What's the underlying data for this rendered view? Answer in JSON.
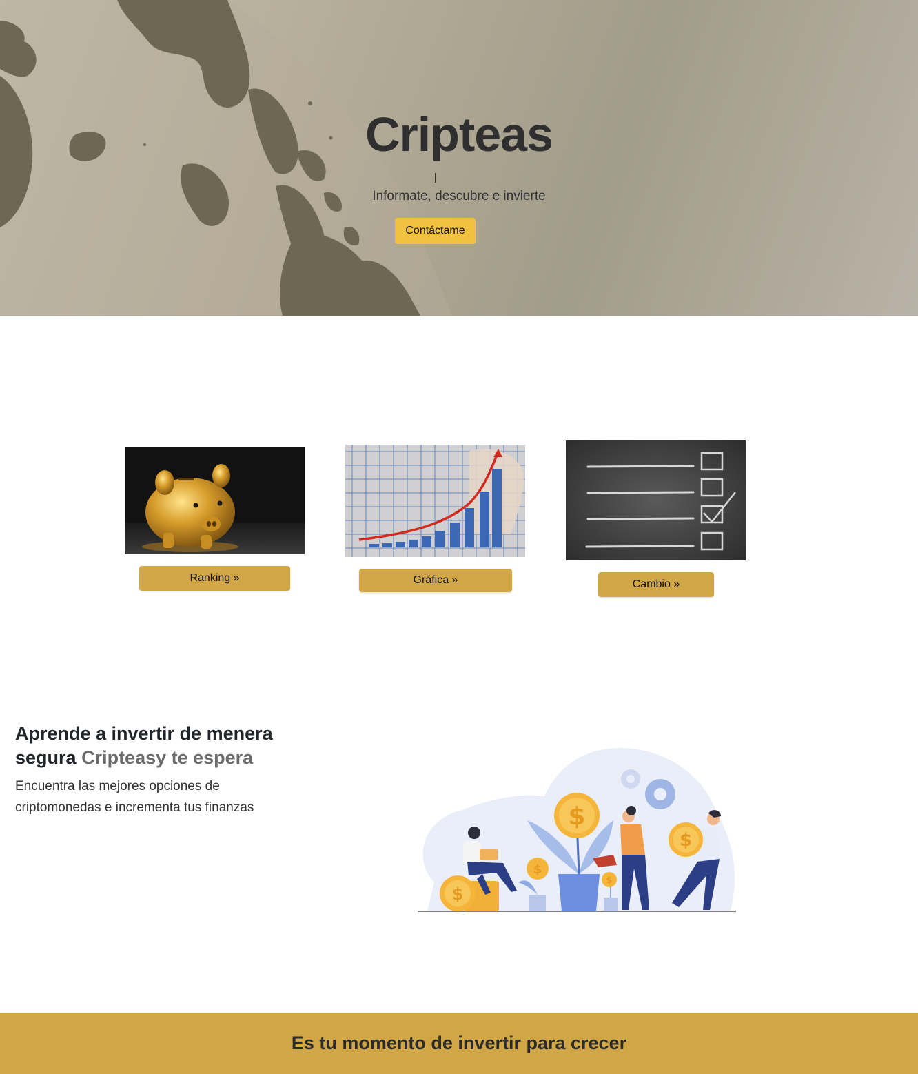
{
  "hero": {
    "title": "Cripteas",
    "subtitle": "Informate, descubre e invierte",
    "contact_button": "Contáctame",
    "button_color": "#f1c240"
  },
  "cards": [
    {
      "image": "piggy-bank-image",
      "button": "Ranking »"
    },
    {
      "image": "growth-chart-image",
      "button": "Gráfica »"
    },
    {
      "image": "checklist-chalkboard-image",
      "button": "Cambio »"
    }
  ],
  "invest": {
    "heading_main": "Aprende a invertir de menera segura",
    "heading_accent": "Cripteasy te espera",
    "text": "Encuentra las mejores opciones de criptomonedas e incrementa tus finanzas",
    "illustration": "investment-growth-illustration"
  },
  "cta": {
    "text": "Es tu momento de invertir para crecer",
    "color": "#d1a646"
  }
}
